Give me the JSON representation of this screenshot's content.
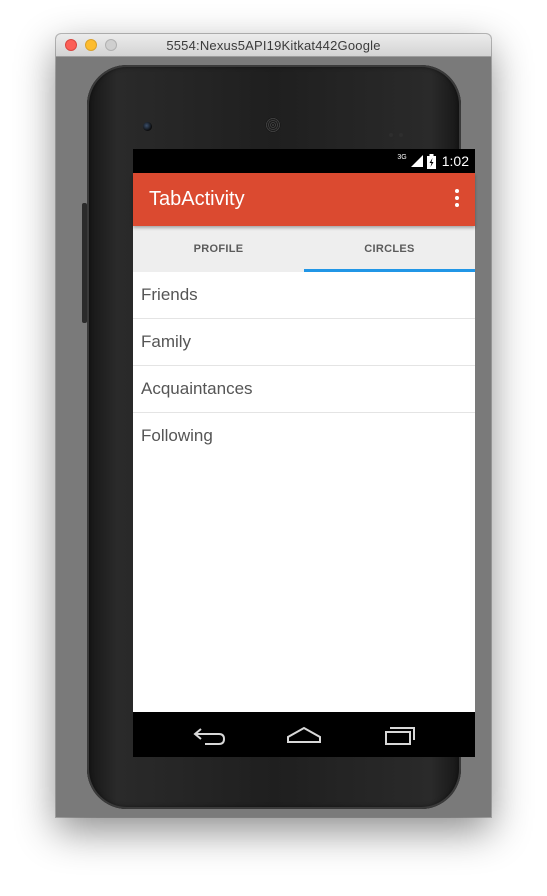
{
  "window": {
    "title": "5554:Nexus5API19Kitkat442Google"
  },
  "status_bar": {
    "network_type": "3G",
    "time": "1:02"
  },
  "action_bar": {
    "title": "TabActivity",
    "overflow_icon": "more-vert-icon"
  },
  "tabs": [
    {
      "label": "PROFILE",
      "selected": false
    },
    {
      "label": "CIRCLES",
      "selected": true
    }
  ],
  "list": {
    "items": [
      {
        "label": "Friends"
      },
      {
        "label": "Family"
      },
      {
        "label": "Acquaintances"
      },
      {
        "label": "Following"
      }
    ]
  },
  "nav_bar": {
    "icons": [
      "back-icon",
      "home-icon",
      "recents-icon"
    ]
  },
  "colors": {
    "accent": "#db4a30",
    "tab_indicator": "#2196e6",
    "tab_background": "#eeeeee"
  }
}
